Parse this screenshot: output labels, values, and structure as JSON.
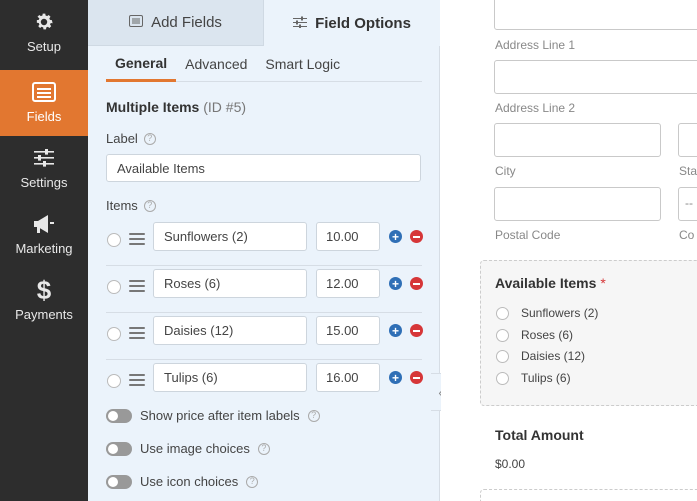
{
  "nav": {
    "items": [
      {
        "label": "Setup",
        "icon": "gear-icon"
      },
      {
        "label": "Fields",
        "icon": "list-icon",
        "active": true
      },
      {
        "label": "Settings",
        "icon": "sliders-icon"
      },
      {
        "label": "Marketing",
        "icon": "megaphone-icon"
      },
      {
        "label": "Payments",
        "icon": "dollar-icon"
      }
    ]
  },
  "panel": {
    "tabs": {
      "add_fields": "Add Fields",
      "field_options": "Field Options"
    },
    "subtabs": {
      "general": "General",
      "advanced": "Advanced",
      "smart_logic": "Smart Logic"
    },
    "field_name": "Multiple Items",
    "field_id": "(ID #5)",
    "label_heading": "Label",
    "label_value": "Available Items",
    "items_heading": "Items",
    "items": [
      {
        "name": "Sunflowers (2)",
        "price": "10.00"
      },
      {
        "name": "Roses (6)",
        "price": "12.00"
      },
      {
        "name": "Daisies (12)",
        "price": "15.00"
      },
      {
        "name": "Tulips (6)",
        "price": "16.00"
      }
    ],
    "toggles": {
      "show_price": "Show price after item labels",
      "image_choices": "Use image choices",
      "icon_choices": "Use icon choices"
    }
  },
  "preview": {
    "address_line1": "Address Line 1",
    "address_line2": "Address Line 2",
    "city": "City",
    "state_partial": "Sta",
    "postal_code": "Postal Code",
    "country_partial": "Co",
    "country_select_partial": "--",
    "available_items_title": "Available Items",
    "required_mark": "*",
    "choices": [
      "Sunflowers (2)",
      "Roses (6)",
      "Daisies (12)",
      "Tulips (6)"
    ],
    "total_title": "Total Amount",
    "total_value": "$0.00"
  },
  "colors": {
    "accent": "#e27730",
    "nav_bg": "#2d2d2d",
    "panel_bg": "#ebf3fb",
    "add_blue": "#2f6fb6",
    "remove_red": "#d63638"
  }
}
